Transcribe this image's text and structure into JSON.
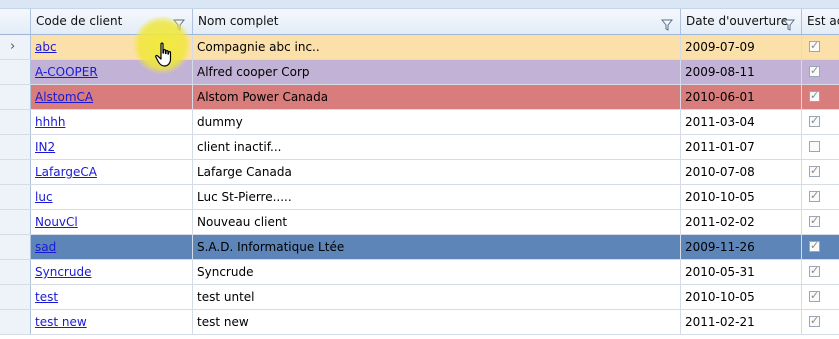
{
  "columns": {
    "code": "Code de client",
    "name": "Nom complet",
    "date": "Date d'ouverture",
    "active": "Est actif"
  },
  "icons": {
    "filter": "filter-funnel-icon",
    "row_indicator": "current-row-arrow-icon",
    "cursor": "hand-pointer-icon"
  },
  "row_indicator_glyph": "›",
  "colors": {
    "row_selected": "#fce0aa",
    "row_purple": "#c2b3d6",
    "row_red": "#d87c7c",
    "row_blue": "#5d85b8",
    "link": "#1a1ad6"
  },
  "rows": [
    {
      "code": "abc",
      "name": "Compagnie abc inc..",
      "date": "2009-07-09",
      "active": true,
      "style": "sel"
    },
    {
      "code": "A-COOPER",
      "name": "Alfred cooper Corp",
      "date": "2009-08-11",
      "active": true,
      "style": "purple"
    },
    {
      "code": "AlstomCA",
      "name": "Alstom Power Canada",
      "date": "2010-06-01",
      "active": true,
      "style": "red"
    },
    {
      "code": "hhhh",
      "name": "dummy",
      "date": "2011-03-04",
      "active": true,
      "style": ""
    },
    {
      "code": "IN2",
      "name": "client inactif...",
      "date": "2011-01-07",
      "active": false,
      "style": ""
    },
    {
      "code": "LafargeCA",
      "name": "Lafarge Canada",
      "date": "2010-07-08",
      "active": true,
      "style": ""
    },
    {
      "code": "luc",
      "name": "Luc St-Pierre.....",
      "date": "2010-10-05",
      "active": true,
      "style": ""
    },
    {
      "code": "NouvCl",
      "name": "Nouveau client",
      "date": "2011-02-02",
      "active": true,
      "style": ""
    },
    {
      "code": "sad",
      "name": "S.A.D. Informatique Ltée",
      "date": "2009-11-26",
      "active": true,
      "style": "blue"
    },
    {
      "code": "Syncrude",
      "name": "Syncrude",
      "date": "2010-05-31",
      "active": true,
      "style": ""
    },
    {
      "code": "test",
      "name": "test untel",
      "date": "2010-10-05",
      "active": true,
      "style": ""
    },
    {
      "code": "test new",
      "name": "test new",
      "date": "2011-02-21",
      "active": true,
      "style": ""
    }
  ]
}
